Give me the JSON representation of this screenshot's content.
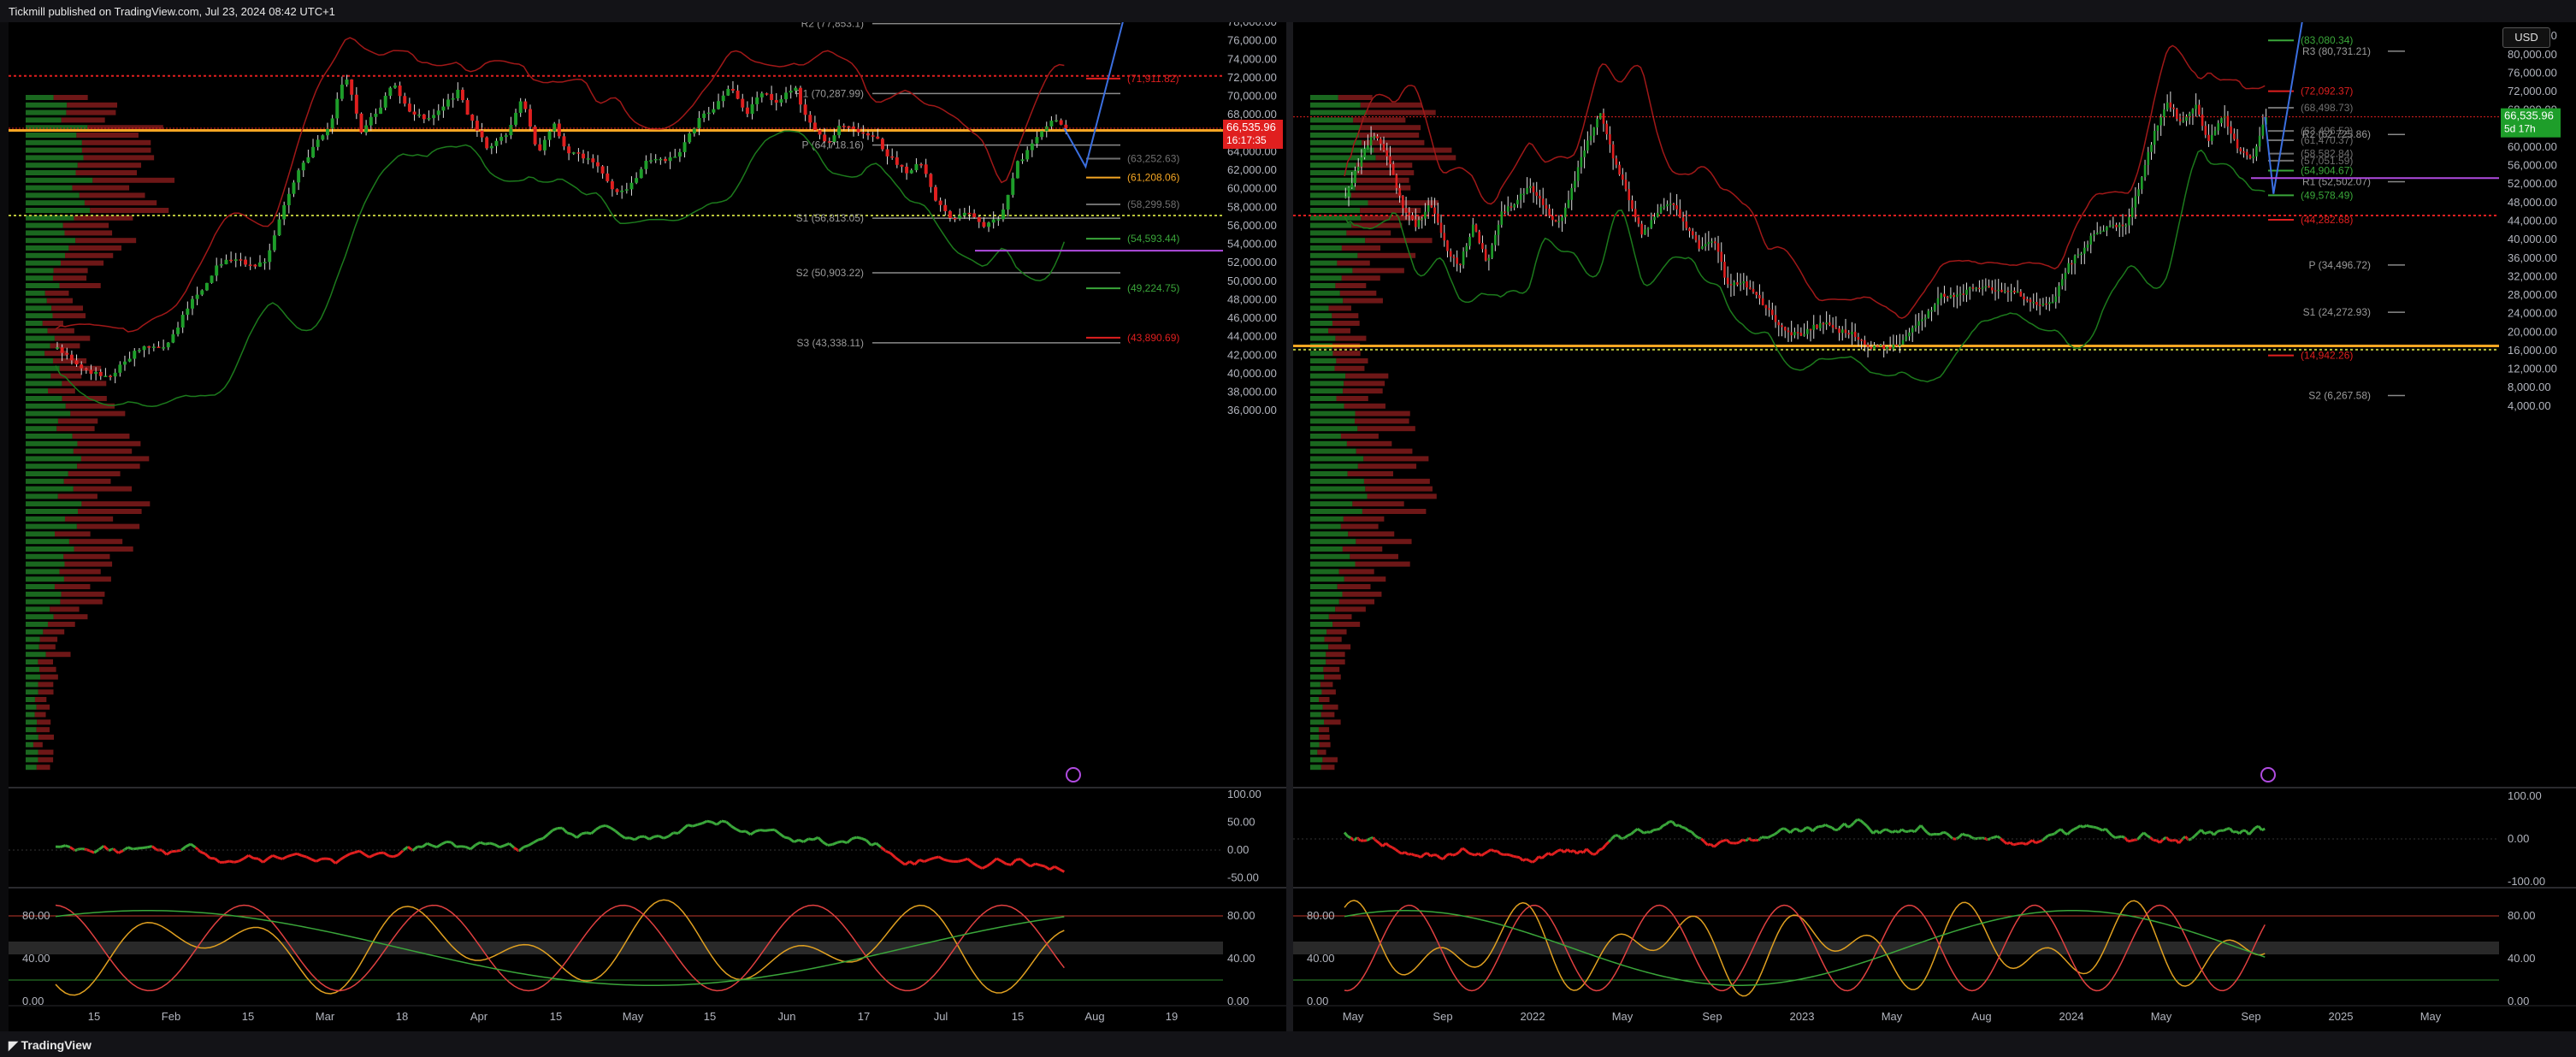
{
  "header": {
    "text": "Tickmill published on TradingView.com, Jul 23, 2024 08:42 UTC+1"
  },
  "footer": {
    "brand": "TradingView"
  },
  "toolbar": {
    "currency": "USD"
  },
  "colors": {
    "up": "#1e9e2a",
    "down": "#e01f1f",
    "accent_orange": "#f5a623",
    "purple": "#b04be0",
    "grid": "#1a1a1a"
  },
  "chart_data": [
    {
      "type": "candlestick",
      "panel": "left",
      "y_axis_ticks": [
        "76,000.00",
        "74,000.00",
        "72,000.00",
        "70,000.00",
        "68,000.00",
        "66,000.00",
        "64,000.00",
        "62,000.00",
        "60,000.00",
        "58,000.00",
        "56,000.00",
        "54,000.00",
        "52,000.00",
        "50,000.00",
        "48,000.00",
        "46,000.00",
        "44,000.00",
        "42,000.00",
        "40,000.00",
        "38,000.00",
        "36,000.00"
      ],
      "y_axis_top_partial": "78,000.00",
      "ylim": [
        35000,
        78000
      ],
      "x_axis_ticks": [
        "15",
        "Feb",
        "15",
        "Mar",
        "18",
        "Apr",
        "15",
        "May",
        "15",
        "Jun",
        "17",
        "Jul",
        "15",
        "Aug",
        "19"
      ],
      "current_price": "66,535.96",
      "countdown": "16:17:35",
      "pivot_levels": [
        {
          "label": "R2 (77,853.1)",
          "value": 77853
        },
        {
          "label": "R1 (70,287.99)",
          "value": 70288
        },
        {
          "label": "P (64,718.16)",
          "value": 64718
        },
        {
          "label": "S1 (56,813.05)",
          "value": 56813
        },
        {
          "label": "S2 (50,903.22)",
          "value": 50903
        },
        {
          "label": "S3 (43,338.11)",
          "value": 43338
        }
      ],
      "level_labels": [
        {
          "label": "(71,911.82)",
          "value": 71912,
          "color": "red"
        },
        {
          "label": "(63,252.63)",
          "value": 63253,
          "color": "gray"
        },
        {
          "label": "(61,208.06)",
          "value": 61208,
          "color": "orange"
        },
        {
          "label": "(58,299.58)",
          "value": 58300,
          "color": "gray"
        },
        {
          "label": "(54,593.44)",
          "value": 54593,
          "color": "green"
        },
        {
          "label": "(49,224.75)",
          "value": 49225,
          "color": "green"
        },
        {
          "label": "(43,890.69)",
          "value": 43891,
          "color": "red"
        }
      ],
      "price_path": [
        42800,
        41200,
        40200,
        39500,
        40800,
        42600,
        42900,
        43200,
        46800,
        49200,
        51800,
        52400,
        51600,
        52100,
        57400,
        61800,
        64500,
        66700,
        72600,
        66200,
        68400,
        71300,
        68500,
        67300,
        68700,
        70600,
        66900,
        64200,
        65800,
        69700,
        63900,
        66900,
        63700,
        63500,
        61800,
        59300,
        60800,
        63400,
        62800,
        64300,
        67400,
        68700,
        71300,
        67800,
        70400,
        69100,
        71200,
        66900,
        64800,
        67200,
        66100,
        65800,
        63400,
        61700,
        62800,
        58200,
        56700,
        57600,
        55900,
        57300,
        62800,
        64900,
        67500,
        66536
      ]
    },
    {
      "type": "oscillator",
      "panel": "left-middle",
      "y_axis_ticks": [
        "100.00",
        "50.00",
        "0.00",
        "-50.00"
      ],
      "ylim": [
        -65,
        105
      ]
    },
    {
      "type": "stochastic",
      "panel": "left-bottom",
      "left_ticks": [
        "80.00",
        "40.00",
        "0.00"
      ],
      "right_ticks": [
        "80.00",
        "40.00",
        "0.00"
      ],
      "ylim": [
        0,
        100
      ]
    },
    {
      "type": "candlestick",
      "panel": "right",
      "y_axis_ticks": [
        "84,000.00",
        "80,000.00",
        "76,000.00",
        "72,000.00",
        "68,000.00",
        "64,000.00",
        "60,000.00",
        "56,000.00",
        "52,000.00",
        "48,000.00",
        "44,000.00",
        "40,000.00",
        "36,000.00",
        "32,000.00",
        "28,000.00",
        "24,000.00",
        "20,000.00",
        "16,000.00",
        "12,000.00",
        "8,000.00",
        "4,000.00"
      ],
      "ylim": [
        1000,
        87000
      ],
      "x_axis_ticks": [
        "May",
        "Sep",
        "2022",
        "May",
        "Sep",
        "2023",
        "May",
        "Aug",
        "2024",
        "May",
        "Sep",
        "2025",
        "May"
      ],
      "current_price": "66,535.96",
      "countdown": "5d 17h",
      "pivot_levels": [
        {
          "label": "R3 (80,731.21)",
          "value": 80731
        },
        {
          "label": "R2 (62,725.86)",
          "value": 62726
        },
        {
          "label": "R1 (52,502.07)",
          "value": 52502
        },
        {
          "label": "P (34,496.72)",
          "value": 34497
        },
        {
          "label": "S1 (24,272.93)",
          "value": 24273
        },
        {
          "label": "S2 (6,267.58)",
          "value": 6268
        }
      ],
      "level_labels": [
        {
          "label": "(83,080.34)",
          "value": 83080,
          "color": "green"
        },
        {
          "label": "(72,092.37)",
          "value": 72092,
          "color": "red"
        },
        {
          "label": "(68,498.73)",
          "value": 68499,
          "color": "gray"
        },
        {
          "label": "(63,496.52)",
          "value": 63497,
          "color": "gray"
        },
        {
          "label": "(61,470.37)",
          "value": 61470,
          "color": "gray"
        },
        {
          "label": "(58,582.84)",
          "value": 58583,
          "color": "gray"
        },
        {
          "label": "(57,051.59)",
          "value": 57052,
          "color": "gray"
        },
        {
          "label": "(54,904.67)",
          "value": 54905,
          "color": "green"
        },
        {
          "label": "(49,578.49)",
          "value": 49578,
          "color": "green"
        },
        {
          "label": "(44,282.68)",
          "value": 44283,
          "color": "red"
        },
        {
          "label": "(14,942.26)",
          "value": 14942,
          "color": "red"
        }
      ],
      "price_path": [
        49000,
        57000,
        63000,
        58000,
        47000,
        43000,
        48000,
        39000,
        34000,
        43000,
        35000,
        46000,
        48000,
        52000,
        47000,
        43000,
        51000,
        61000,
        67000,
        57000,
        49000,
        41000,
        46000,
        48000,
        43000,
        38000,
        40000,
        30000,
        31000,
        28000,
        24000,
        20000,
        19500,
        21000,
        21800,
        20000,
        19500,
        16800,
        16600,
        17200,
        21000,
        23500,
        28000,
        27800,
        29000,
        30200,
        28500,
        29500,
        27000,
        26000,
        27100,
        34500,
        37500,
        42000,
        43000,
        42500,
        51000,
        62000,
        70000,
        65000,
        69000,
        61000,
        67000,
        60000,
        57000,
        66536
      ]
    },
    {
      "type": "oscillator",
      "panel": "right-middle",
      "y_axis_ticks": [
        "100.00",
        "0.00",
        "-100.00"
      ],
      "ylim": [
        -110,
        110
      ]
    },
    {
      "type": "stochastic",
      "panel": "right-bottom",
      "left_ticks": [
        "80.00",
        "40.00",
        "0.00"
      ],
      "right_ticks": [
        "80.00",
        "40.00",
        "0.00"
      ],
      "ylim": [
        0,
        100
      ]
    }
  ]
}
